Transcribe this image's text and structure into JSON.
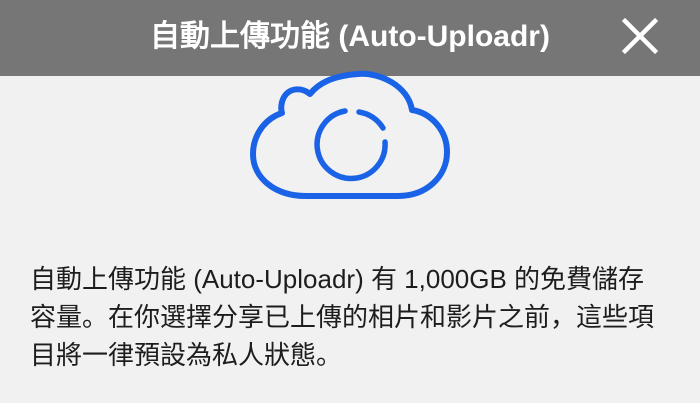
{
  "header": {
    "title": "自動上傳功能 (Auto-Uploadr)",
    "close_icon": "close-icon"
  },
  "illustration": {
    "icon": "cloud-sync-icon",
    "color": "#1a63e6"
  },
  "body": {
    "description": "自動上傳功能 (Auto-Uploadr) 有 1,000GB 的免費儲存容量。在你選擇分享已上傳的相片和影片之前，這些項目將一律預設為私人狀態。"
  },
  "colors": {
    "header_bg": "#767676",
    "page_bg": "#f1f1f1",
    "text": "#1d1d1d",
    "accent": "#1a63e6"
  }
}
